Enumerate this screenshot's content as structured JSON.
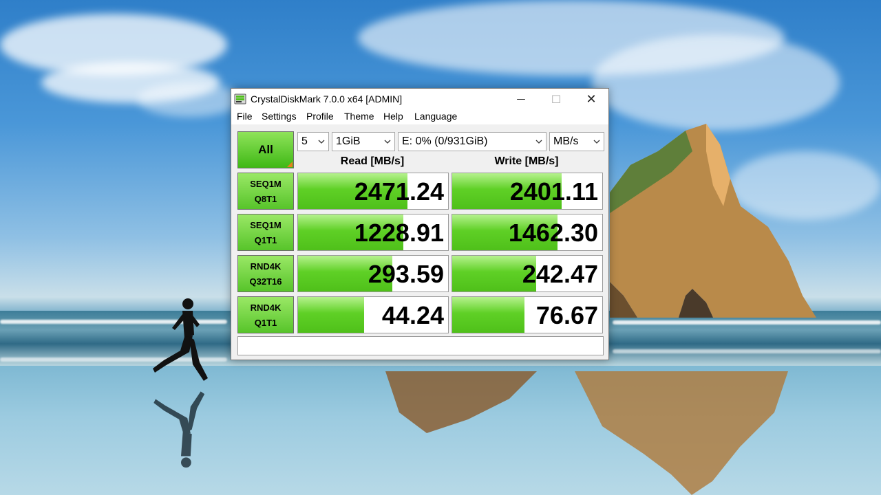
{
  "window": {
    "title": "CrystalDiskMark 7.0.0 x64 [ADMIN]",
    "title_buttons": {
      "minimize": "—",
      "maximize": "☐",
      "close": "✕"
    }
  },
  "menu": [
    "File",
    "Settings",
    "Profile",
    "Theme",
    "Help",
    "Language"
  ],
  "toolbar": {
    "all_label": "All",
    "count": "5",
    "size": "1GiB",
    "drive": "E: 0% (0/931GiB)",
    "unit": "MB/s"
  },
  "headers": {
    "read": "Read [MB/s]",
    "write": "Write [MB/s]"
  },
  "tests": [
    {
      "line1": "SEQ1M",
      "line2": "Q8T1",
      "read": "2471.24",
      "write": "2401.11",
      "read_fill": 0.73,
      "write_fill": 0.73
    },
    {
      "line1": "SEQ1M",
      "line2": "Q1T1",
      "read": "1228.91",
      "write": "1462.30",
      "read_fill": 0.7,
      "write_fill": 0.7
    },
    {
      "line1": "RND4K",
      "line2": "Q32T16",
      "read": "293.59",
      "write": "242.47",
      "read_fill": 0.63,
      "write_fill": 0.56
    },
    {
      "line1": "RND4K",
      "line2": "Q1T1",
      "read": "44.24",
      "write": "76.67",
      "read_fill": 0.44,
      "write_fill": 0.48
    }
  ],
  "comment": "",
  "colors": {
    "bar_green": "#5fd026",
    "button_green": "#57c42a",
    "accent_orange": "#e8801f",
    "sky": "#4a97d8"
  },
  "icons": {
    "app": "crystaldiskmark-icon",
    "dropdown": "chevron-down-icon"
  }
}
